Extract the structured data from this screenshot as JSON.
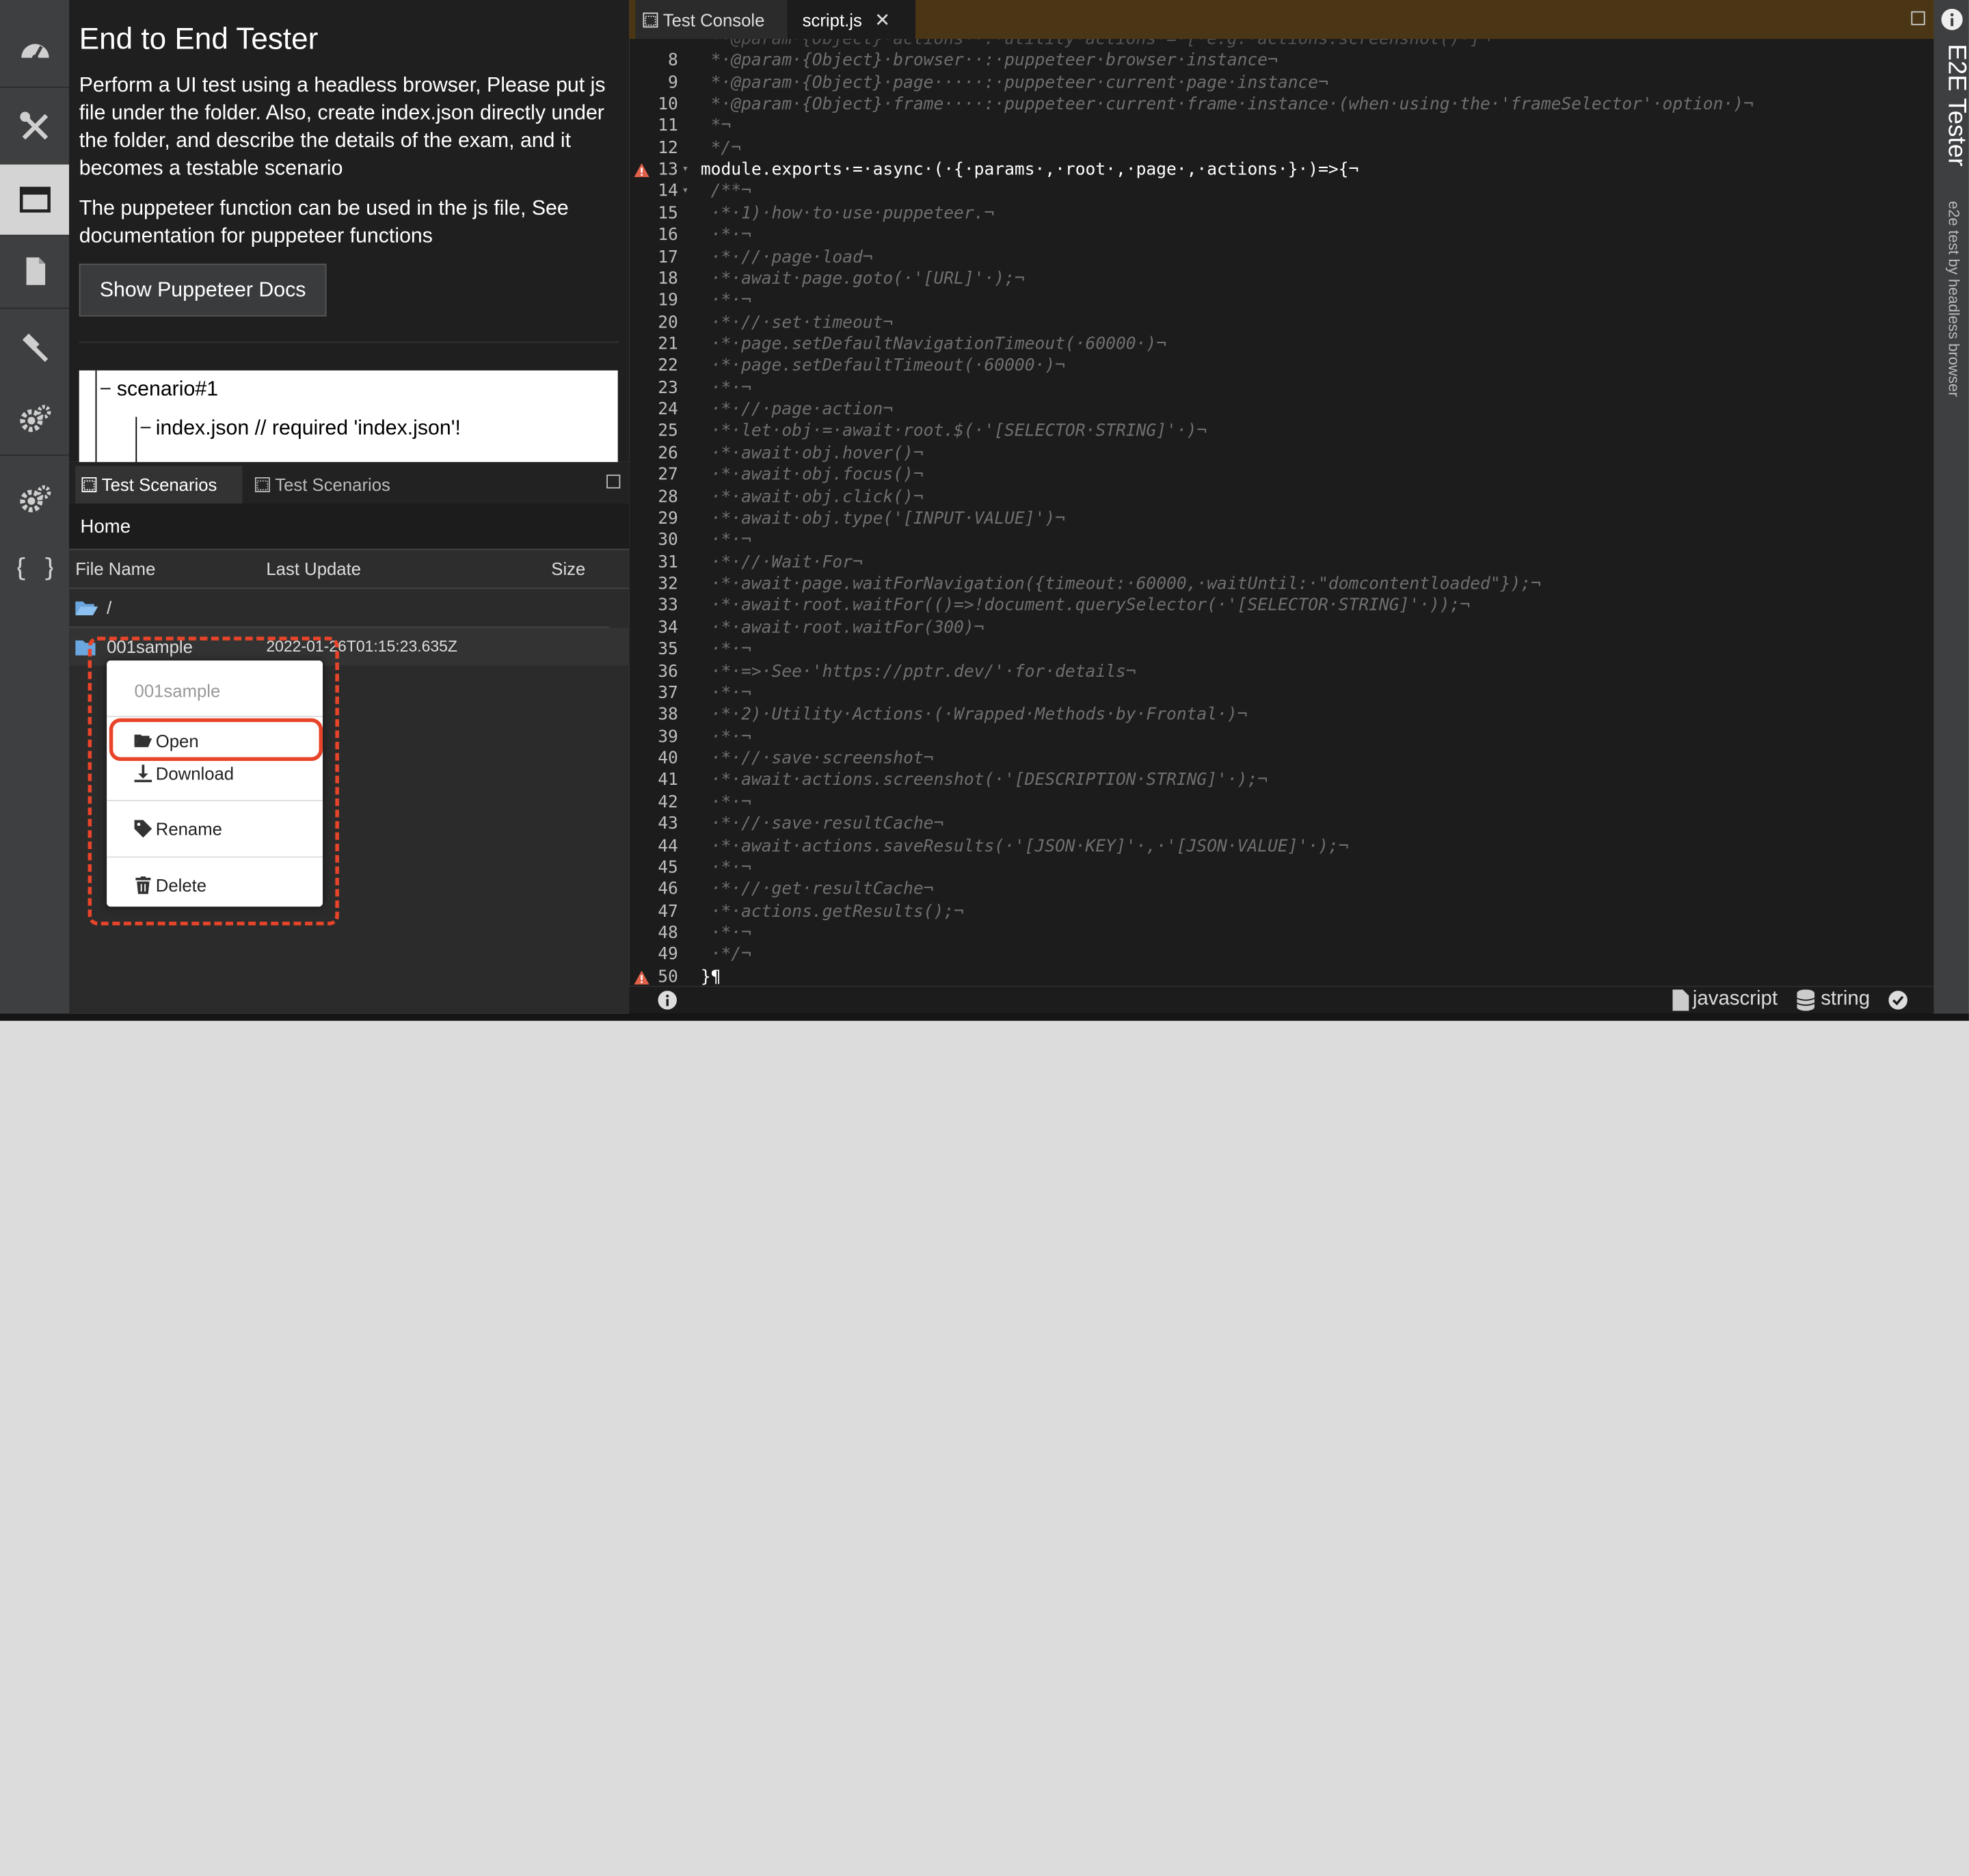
{
  "doc": {
    "title": "End to End Tester",
    "para1": "Perform a UI test using a headless browser, Please put js file under the folder. Also, create index.json directly under the folder, and describe the details of the exam, and it becomes a testable scenario",
    "para2": "The puppeteer function can be used in the js file, See documentation for puppeteer functions",
    "docs_button": "Show Puppeteer Docs",
    "tree": [
      "scenario#1",
      "index.json // required 'index.json'!"
    ]
  },
  "scenarios": {
    "tabs": [
      "Test Scenarios",
      "Test Scenarios"
    ],
    "breadcrumb": "Home",
    "columns": [
      "File Name",
      "Last Update",
      "Size"
    ],
    "rows": [
      {
        "name": "/",
        "updated": "",
        "size": ""
      },
      {
        "name": "001sample",
        "updated": "2022-01-26T01:15:23.635Z",
        "size": ""
      }
    ],
    "context_menu": {
      "header": "001sample",
      "items": [
        "Open",
        "Download",
        "Rename",
        "Delete"
      ]
    }
  },
  "editor": {
    "tabs": [
      "Test Console",
      "script.js"
    ],
    "language": "javascript",
    "type": "string"
  },
  "rail": {
    "title": "E2E Tester",
    "subtitle": "e2e test by headless browser"
  },
  "code": [
    {
      "n": "8",
      "t": " *·@param·{Object}·browser··:·puppeteer·browser·instance¬",
      "c": "cm"
    },
    {
      "n": "9",
      "t": " *·@param·{Object}·page·····:·puppeteer·current·page·instance¬",
      "c": "cm"
    },
    {
      "n": "10",
      "t": " *·@param·{Object}·frame····:·puppeteer·current·frame·instance·(when·using·the·'frameSelector'·option·)¬",
      "c": "cm"
    },
    {
      "n": "11",
      "t": " *¬",
      "c": "cm"
    },
    {
      "n": "12",
      "t": " */¬",
      "c": "cm"
    },
    {
      "n": "13",
      "t": "module.exports·=·async·(·{·params·,·root·,·page·,·actions·}·)=>{¬",
      "c": "pl",
      "warn": true,
      "fold": true
    },
    {
      "n": "14",
      "t": " /**¬",
      "c": "cm",
      "fold": true
    },
    {
      "n": "15",
      "t": " ·*·1)·how·to·use·puppeteer.¬",
      "c": "cm"
    },
    {
      "n": "16",
      "t": " ·*·¬",
      "c": "cm"
    },
    {
      "n": "17",
      "t": " ·*·//·page·load¬",
      "c": "cm"
    },
    {
      "n": "18",
      "t": " ·*·await·page.goto(·'[URL]'·);¬",
      "c": "cm"
    },
    {
      "n": "19",
      "t": " ·*·¬",
      "c": "cm"
    },
    {
      "n": "20",
      "t": " ·*·//·set·timeout¬",
      "c": "cm"
    },
    {
      "n": "21",
      "t": " ·*·page.setDefaultNavigationTimeout(·60000·)¬",
      "c": "cm"
    },
    {
      "n": "22",
      "t": " ·*·page.setDefaultTimeout(·60000·)¬",
      "c": "cm"
    },
    {
      "n": "23",
      "t": " ·*·¬",
      "c": "cm"
    },
    {
      "n": "24",
      "t": " ·*·//·page·action¬",
      "c": "cm"
    },
    {
      "n": "25",
      "t": " ·*·let·obj·=·await·root.$(·'[SELECTOR·STRING]'·)¬",
      "c": "cm"
    },
    {
      "n": "26",
      "t": " ·*·await·obj.hover()¬",
      "c": "cm"
    },
    {
      "n": "27",
      "t": " ·*·await·obj.focus()¬",
      "c": "cm"
    },
    {
      "n": "28",
      "t": " ·*·await·obj.click()¬",
      "c": "cm"
    },
    {
      "n": "29",
      "t": " ·*·await·obj.type('[INPUT·VALUE]')¬",
      "c": "cm"
    },
    {
      "n": "30",
      "t": " ·*·¬",
      "c": "cm"
    },
    {
      "n": "31",
      "t": " ·*·//·Wait·For¬",
      "c": "cm"
    },
    {
      "n": "32",
      "t": " ·*·await·page.waitForNavigation({timeout:·60000,·waitUntil:·\"domcontentloaded\"});¬",
      "c": "cm"
    },
    {
      "n": "33",
      "t": " ·*·await·root.waitFor(()=>!document.querySelector(·'[SELECTOR·STRING]'·));¬",
      "c": "cm"
    },
    {
      "n": "34",
      "t": " ·*·await·root.waitFor(300)¬",
      "c": "cm"
    },
    {
      "n": "35",
      "t": " ·*·¬",
      "c": "cm"
    },
    {
      "n": "36",
      "t": " ·*·=>·See·'https://pptr.dev/'·for·details¬",
      "c": "cm"
    },
    {
      "n": "37",
      "t": " ·*·¬",
      "c": "cm"
    },
    {
      "n": "38",
      "t": " ·*·2)·Utility·Actions·(·Wrapped·Methods·by·Frontal·)¬",
      "c": "cm"
    },
    {
      "n": "39",
      "t": " ·*·¬",
      "c": "cm"
    },
    {
      "n": "40",
      "t": " ·*·//·save·screenshot¬",
      "c": "cm"
    },
    {
      "n": "41",
      "t": " ·*·await·actions.screenshot(·'[DESCRIPTION·STRING]'·);¬",
      "c": "cm"
    },
    {
      "n": "42",
      "t": " ·*·¬",
      "c": "cm"
    },
    {
      "n": "43",
      "t": " ·*·//·save·resultCache¬",
      "c": "cm"
    },
    {
      "n": "44",
      "t": " ·*·await·actions.saveResults(·'[JSON·KEY]'·,·'[JSON·VALUE]'·);¬",
      "c": "cm"
    },
    {
      "n": "45",
      "t": " ·*·¬",
      "c": "cm"
    },
    {
      "n": "46",
      "t": " ·*·//·get·resultCache¬",
      "c": "cm"
    },
    {
      "n": "47",
      "t": " ·*·actions.getResults();¬",
      "c": "cm"
    },
    {
      "n": "48",
      "t": " ·*·¬",
      "c": "cm"
    },
    {
      "n": "49",
      "t": " ·*/¬",
      "c": "cm"
    },
    {
      "n": "50",
      "t": "}¶",
      "c": "pl",
      "warn": true
    }
  ],
  "colors": {
    "accent": "#e8442a",
    "tab_bar": "#4a3615",
    "editor_bg": "#1c1c1c"
  }
}
